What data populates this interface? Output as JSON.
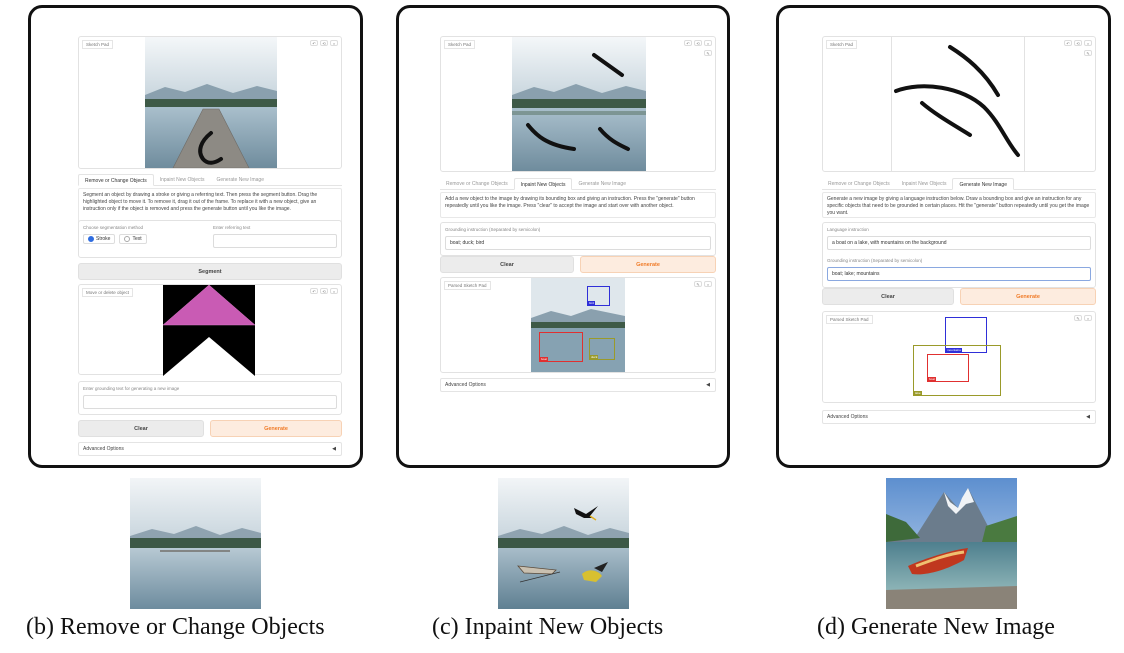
{
  "panels": [
    {
      "sketch_label": "Sketch Pad",
      "tabs": [
        "Remove or Change Objects",
        "Inpaint New Objects",
        "Generate New Image"
      ],
      "active_tab": 0,
      "description": "Segment an object by drawing a stroke or giving a referring text. Then press the segment button. Drag the highlighted object to move it. To remove it, drag it out of the frame. To replace it with a new object, give an instruction only if the object is removed and press the generate button until you like the image.",
      "seg_method_label": "Choose segmentation method",
      "radio_stroke": "Stroke",
      "radio_text": "Text",
      "referring_label": "Enter referring text",
      "referring_value": "",
      "segment_button": "Segment",
      "move_label": "Move or delete object",
      "grounding_label": "Enter grounding text for generating a new image",
      "grounding_value": "",
      "clear_button": "Clear",
      "generate_button": "Generate",
      "advanced_label": "Advanced Options"
    },
    {
      "sketch_label": "Sketch Pad",
      "tabs": [
        "Remove or Change Objects",
        "Inpaint New Objects",
        "Generate New Image"
      ],
      "active_tab": 1,
      "description": "Add a new object to the image by drawing its bounding box and giving an instruction. Press the \"generate\" button repeatedly until you like the image. Press \"clear\" to accept the image and start over with another object.",
      "grounding_label": "Grounding instruction (Separated by semicolon)",
      "grounding_value": "boat; duck; bird",
      "clear_button": "Clear",
      "generate_button": "Generate",
      "parsed_label": "Parsed Sketch Pad",
      "box_tags": [
        "bird",
        "boat",
        "duck"
      ],
      "advanced_label": "Advanced Options"
    },
    {
      "sketch_label": "Sketch Pad",
      "tabs": [
        "Remove or Change Objects",
        "Inpaint New Objects",
        "Generate New Image"
      ],
      "active_tab": 2,
      "description": "Generate a new image by giving a language instruction below. Draw a bounding box and give an instruction for any specific objects that need to be grounded in certain places. Hit the \"generate\" button repeatedly until you get the image you want.",
      "language_label": "Language instruction",
      "language_value": "a boat on a lake, with mountains on the background",
      "grounding_label": "Grounding instruction (Separated by semicolon)",
      "grounding_value": "boat; lake; mountains",
      "clear_button": "Clear",
      "generate_button": "Generate",
      "parsed_label": "Parsed Sketch Pad",
      "box_tags": [
        "mountains",
        "boat",
        "lake"
      ],
      "advanced_label": "Advanced Options"
    }
  ],
  "captions": [
    "(b) Remove or Change Objects",
    "(c) Inpaint New Objects",
    "(d) Generate New Image"
  ],
  "colors": {
    "generate_text": "#f07a26",
    "radio_active": "#2f6de0",
    "box_blue": "#2f2fd8",
    "box_red": "#e03030",
    "box_olive": "#9a9a2a"
  }
}
